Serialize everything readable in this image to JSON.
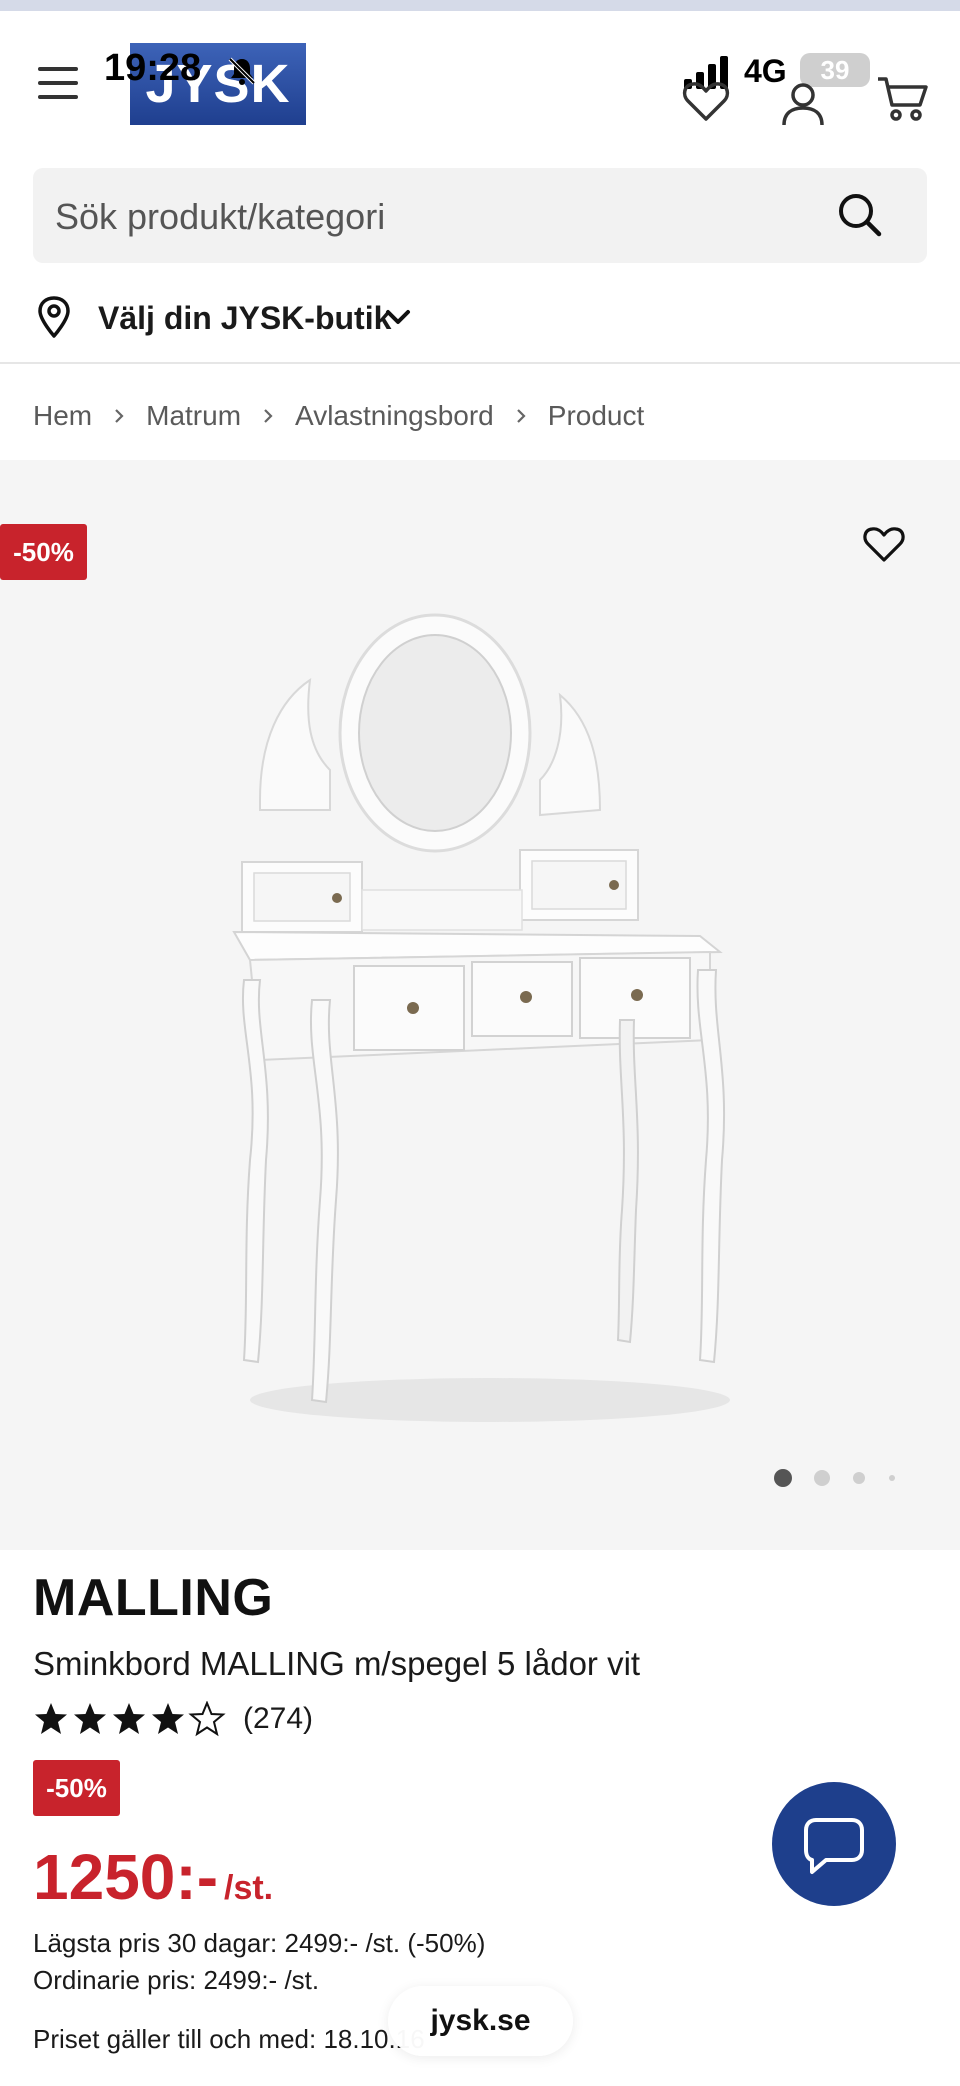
{
  "status_bar": {
    "time": "19:28",
    "network": "4G",
    "battery": "39"
  },
  "header": {
    "logo_text": "JYSK",
    "menu_icon": "hamburger-icon",
    "wishlist_icon": "heart-icon",
    "account_icon": "user-icon",
    "cart_icon": "cart-icon"
  },
  "search": {
    "placeholder": "Sök produkt/kategori"
  },
  "store": {
    "label": "Välj din JYSK-butik"
  },
  "breadcrumb": [
    "Hem",
    "Matrum",
    "Avlastningsbord",
    "Product"
  ],
  "gallery": {
    "discount": "-50%",
    "image_count": 4,
    "active_image": 1
  },
  "product": {
    "brand": "MALLING",
    "name": "Sminkbord MALLING m/spegel 5 lådor vit",
    "rating": 4,
    "rating_max": 5,
    "reviews": "(274)",
    "discount": "-50%",
    "price": "1250:-",
    "price_unit": "/st.",
    "lowest_price": "Lägsta pris 30 dagar: 2499:- /st. (-50%)",
    "regular_price": "Ordinarie pris: 2499:- /st.",
    "valid_until": "Priset gäller till och med: 18.10.16"
  },
  "browser": {
    "url": "jysk.se"
  },
  "colors": {
    "brand_blue": "#1e3f8c",
    "sale_red": "#c8232c"
  }
}
